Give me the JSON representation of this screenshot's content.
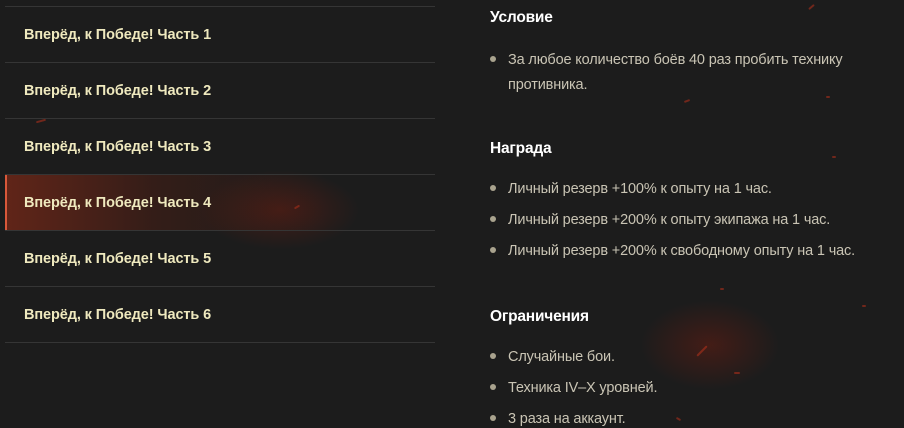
{
  "missions": [
    {
      "label": "Вперёд, к Победе! Часть 1",
      "active": false
    },
    {
      "label": "Вперёд, к Победе! Часть 2",
      "active": false
    },
    {
      "label": "Вперёд, к Победе! Часть 3",
      "active": false
    },
    {
      "label": "Вперёд, к Победе! Часть 4",
      "active": true
    },
    {
      "label": "Вперёд, к Победе! Часть 5",
      "active": false
    },
    {
      "label": "Вперёд, к Победе! Часть 6",
      "active": false
    }
  ],
  "details": {
    "condition": {
      "title": "Условие",
      "items": [
        "За любое количество боёв 40 раз пробить технику противника."
      ]
    },
    "reward": {
      "title": "Награда",
      "items": [
        "Личный резерв +100% к опыту на 1 час.",
        "Личный резерв +200% к опыту экипажа на 1 час.",
        "Личный резерв +200% к свободному опыту на 1 час."
      ]
    },
    "restrictions": {
      "title": "Ограничения",
      "items": [
        "Случайные бои.",
        "Техника IV–X уровней.",
        "3 раза на аккаунт."
      ]
    }
  },
  "colors": {
    "background": "#1c1c1c",
    "mission_label": "#efe9be",
    "active_accent": "#d9583a",
    "section_title": "#ffffff",
    "body_text": "#c9c4b4"
  }
}
